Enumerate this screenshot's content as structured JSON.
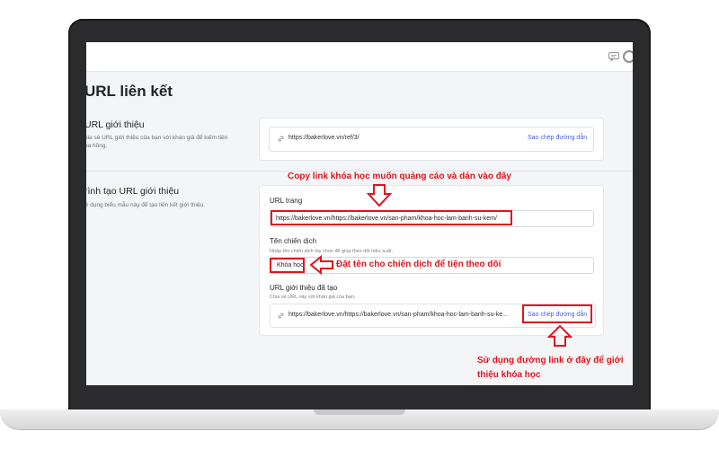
{
  "page": {
    "title": "URL liên kết"
  },
  "icons": {
    "chat": "chat-bubble-icon",
    "avatar": "user-avatar-icon",
    "link": "link-icon"
  },
  "referral_section": {
    "title": "URL giới thiệu",
    "desc_line1": "hia sẻ URL giới thiệu của bạn với khán giả để kiếm tiền",
    "desc_line2": "oa hồng.",
    "url": "https://bakerlove.vn/ref/3/",
    "copy_label": "Sao chép đường dẫn"
  },
  "builder_section": {
    "title": "rình tạo URL giới thiệu",
    "desc": "ử dụng biểu mẫu này để tạo liên kết giới thiệu.",
    "page_url": {
      "label": "URL trang",
      "value": "https://bakerlove.vn/https://bakerlove.vn/san-pham/khoa-hoc-lam-banh-su-kem/"
    },
    "campaign": {
      "label": "Tên chiến dịch",
      "help": "Nhập tên chiến dịch tùy chọn để giúp theo dõi hiệu suất.",
      "value": "Khóa học"
    },
    "generated": {
      "label": "URL giới thiệu đã tạo",
      "help": "Chia sẻ URL này với khán giả của bạn.",
      "url": "https://bakerlove.vn/https://bakerlove.vn/san-pham/khoa-hoc-lam-banh-su-ke...",
      "copy_label": "Sao chép đường dẫn"
    }
  },
  "annotations": {
    "copy_link": "Copy link khóa học muốn quảng cáo và dán vào đây",
    "name_campaign": "Đặt tên cho chiến dịch để tiện theo dõi",
    "use_link_line1": "Sử dụng đường link ở đây để giới",
    "use_link_line2": "thiệu khóa học"
  },
  "colors": {
    "annotation": "#e0141e",
    "link_button": "#4a5fd1",
    "screen_bg": "#f4f5f7",
    "bezel": "#2b2b2d"
  }
}
